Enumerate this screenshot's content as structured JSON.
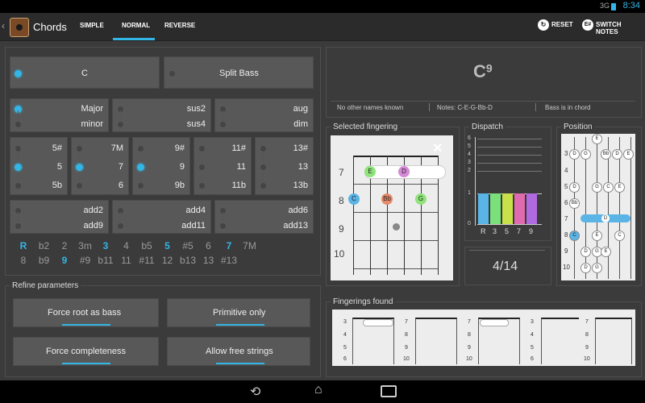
{
  "status": {
    "time": "8:34",
    "signal": "3G"
  },
  "app": {
    "title": "Chords"
  },
  "tabs": [
    {
      "label": "SIMPLE"
    },
    {
      "label": "NORMAL"
    },
    {
      "label": "REVERSE"
    }
  ],
  "actions": {
    "reset": "RESET",
    "switch_notes": "SWITCH NOTES",
    "switch_icon_label": "E#"
  },
  "root_row": {
    "root": "C",
    "split_bass": "Split Bass"
  },
  "groups": {
    "third": [
      "Major",
      "minor"
    ],
    "sus": [
      "sus2",
      "sus4"
    ],
    "aug": [
      "aug",
      "dim"
    ],
    "fifth": [
      "5#",
      "5",
      "5b"
    ],
    "seventh": [
      "7M",
      "7",
      "6"
    ],
    "ninth": [
      "9#",
      "9",
      "9b"
    ],
    "eleventh": [
      "11#",
      "11",
      "11b"
    ],
    "thirteenth": [
      "13#",
      "13",
      "13b"
    ],
    "add_a": [
      "add2",
      "add9"
    ],
    "add_b": [
      "add4",
      "add11"
    ],
    "add_c": [
      "add6",
      "add13"
    ]
  },
  "intervals": {
    "row1": [
      "R",
      "b2",
      "2",
      "3m",
      "3",
      "4",
      "b5",
      "5",
      "#5",
      "6",
      "7",
      "7M"
    ],
    "row2": [
      "8",
      "b9",
      "9",
      "#9",
      "b11",
      "11",
      "#11",
      "12",
      "b13",
      "13",
      "#13"
    ]
  },
  "refine": {
    "title": "Refine parameters",
    "force_root": "Force root as bass",
    "primitive": "Primitive only",
    "completeness": "Force completeness",
    "free_strings": "Allow free strings"
  },
  "chord": {
    "name": "C",
    "sup": "9",
    "other_names": "No other names known",
    "notes": "Notes: C-E-G-Bb-D",
    "bass": "Bass is in chord"
  },
  "fingering": {
    "title": "Selected fingering",
    "close": "✕",
    "frets": [
      "7",
      "8",
      "9",
      "10"
    ],
    "notes": [
      "E",
      "D",
      "C",
      "Bb",
      "G"
    ],
    "note_colors": {
      "E": "#8fe37a",
      "D": "#d48ad6",
      "C": "#5ab4e5",
      "Bb": "#e58a6a",
      "G": "#8fe37a"
    }
  },
  "dispatch": {
    "title": "Dispatch",
    "yticks": [
      "6",
      "5",
      "4",
      "3",
      "2",
      "1",
      "0"
    ],
    "bars": [
      "R",
      "3",
      "5",
      "7",
      "9"
    ],
    "bar_colors": [
      "#5ab4e5",
      "#7be07b",
      "#c8e04a",
      "#e06ab0",
      "#b06ae0"
    ],
    "count": "4/14"
  },
  "position": {
    "title": "Position",
    "frets": [
      "3",
      "4",
      "5",
      "6",
      "7",
      "8",
      "9",
      "10"
    ],
    "row3": [
      "D",
      "G",
      "Bb",
      "D",
      "E"
    ],
    "row5": [
      "D",
      "G",
      "C",
      "E"
    ],
    "row6": [
      "Bb"
    ],
    "row7": [
      "D"
    ],
    "row8": [
      "C",
      "E",
      "C"
    ],
    "row9": [
      "D",
      "G"
    ],
    "row10": [
      "D",
      "G",
      "E"
    ],
    "row11": [
      "D",
      "G"
    ],
    "row4": [
      "E"
    ]
  },
  "found": {
    "title": "Fingerings found",
    "thumbs": [
      {
        "frets": [
          "3",
          "4",
          "5",
          "6"
        ]
      },
      {
        "frets": [
          "7",
          "8",
          "9",
          "10"
        ]
      },
      {
        "frets": [
          "7",
          "8",
          "9",
          "10"
        ]
      },
      {
        "frets": [
          "3",
          "4",
          "5",
          "6"
        ]
      },
      {
        "frets": [
          "7",
          "8",
          "9",
          "10"
        ]
      }
    ]
  },
  "nav": {
    "back": "back-icon",
    "home": "home-icon",
    "recents": "recents-icon"
  },
  "colors": {
    "accent": "#33b5e5",
    "bg": "#3b3b3b",
    "button": "#585858"
  }
}
